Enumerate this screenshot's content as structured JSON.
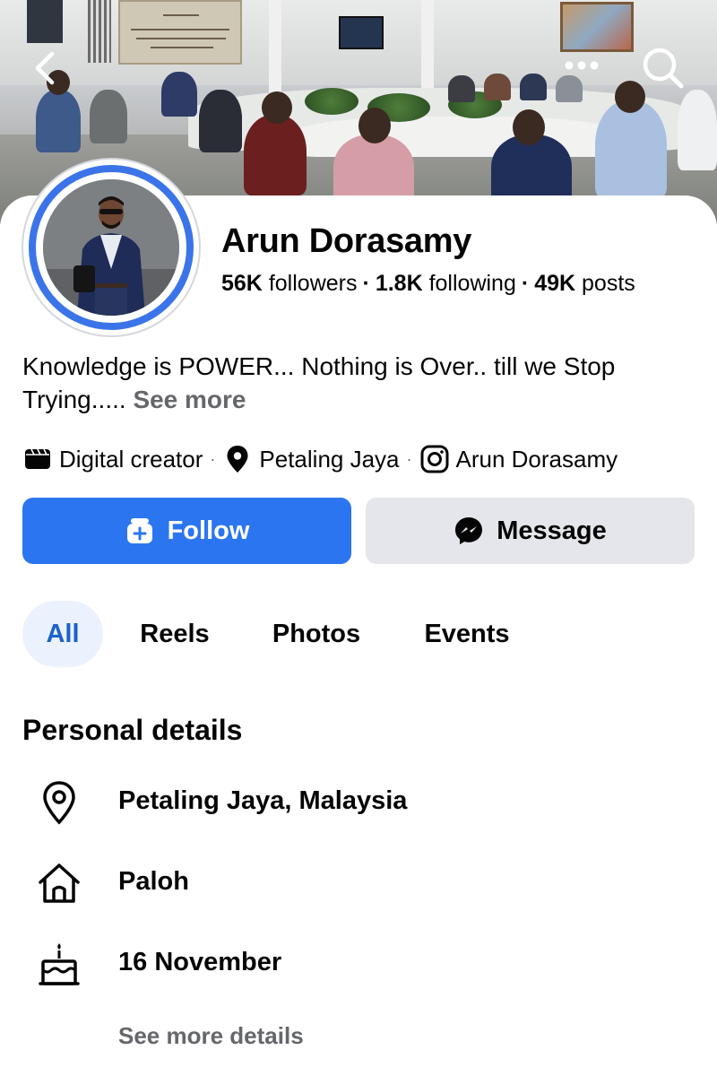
{
  "profile": {
    "name": "Arun Dorasamy",
    "stats": {
      "followers_count": "56K",
      "followers_label": "followers",
      "following_count": "1.8K",
      "following_label": "following",
      "posts_count": "49K",
      "posts_label": "posts",
      "separator": "·"
    },
    "bio": "Knowledge is POWER... Nothing is Over.. till we Stop Trying.....",
    "bio_see_more": "See more",
    "meta": {
      "category": "Digital creator",
      "location": "Petaling Jaya",
      "instagram": "Arun Dorasamy",
      "separator": "·"
    }
  },
  "actions": {
    "follow_label": "Follow",
    "message_label": "Message"
  },
  "tabs": [
    {
      "label": "All",
      "active": true
    },
    {
      "label": "Reels",
      "active": false
    },
    {
      "label": "Photos",
      "active": false
    },
    {
      "label": "Events",
      "active": false
    }
  ],
  "personal_details": {
    "title": "Personal details",
    "items": [
      {
        "icon": "location-pin-icon",
        "text": "Petaling Jaya, Malaysia"
      },
      {
        "icon": "home-icon",
        "text": "Paloh"
      },
      {
        "icon": "birthday-cake-icon",
        "text": "16 November"
      }
    ],
    "see_more_label": "See more details"
  },
  "colors": {
    "accent": "#2b76f0",
    "active_tab_bg": "#ebf2fd",
    "active_tab_text": "#1c62c8",
    "secondary_button": "#e4e6eb",
    "secondary_text": "#65676b",
    "avatar_ring": "#3b74e9"
  }
}
